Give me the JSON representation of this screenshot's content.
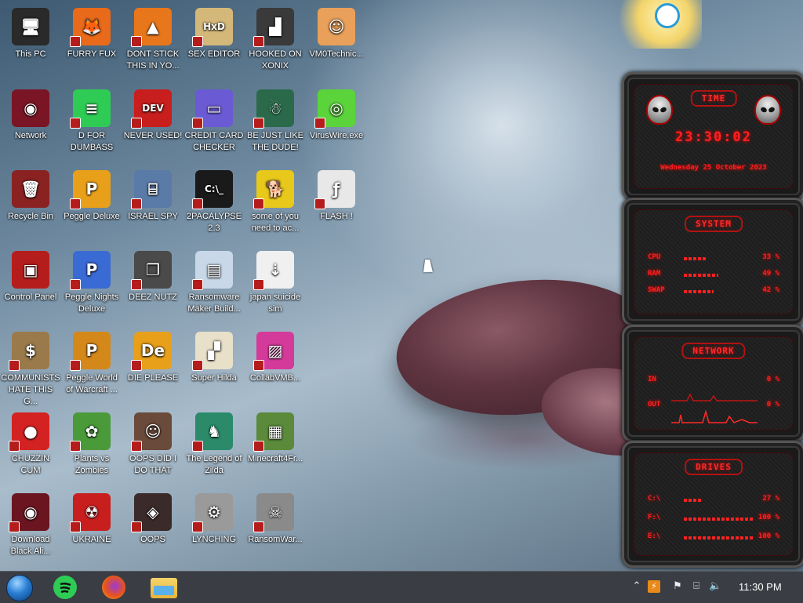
{
  "desktop": {
    "icons": [
      {
        "label": "This PC",
        "icon": "computer-icon",
        "color": "#2a2a2a",
        "glyph": "🖥"
      },
      {
        "label": "Network",
        "icon": "network-icon",
        "color": "#7a1525",
        "glyph": "◉"
      },
      {
        "label": "Recycle Bin",
        "icon": "recycle-bin-icon",
        "color": "#8a2222",
        "glyph": "🗑"
      },
      {
        "label": "Control Panel",
        "icon": "control-panel-icon",
        "color": "#b51d1d",
        "glyph": "▣"
      },
      {
        "label": "COMMUNISTS HATE THIS G...",
        "icon": "money-bag-icon",
        "color": "#9a7a4a",
        "glyph": "$"
      },
      {
        "label": "CHUZZIN CUM",
        "icon": "chuzzle-icon",
        "color": "#d42222",
        "glyph": "●"
      },
      {
        "label": "Download Black Ali...",
        "icon": "alien-icon",
        "color": "#6a1520",
        "glyph": "◉"
      },
      {
        "label": "FURRY FUX",
        "icon": "firefox-icon",
        "color": "#e86a1a",
        "glyph": "🦊"
      },
      {
        "label": "D FOR DUMBASS",
        "icon": "spotify-like-icon",
        "color": "#2ecc55",
        "glyph": "≡"
      },
      {
        "label": "Peggle Deluxe",
        "icon": "peggle-icon",
        "color": "#e8a01a",
        "glyph": "P"
      },
      {
        "label": "Peggle Nights Deluxe",
        "icon": "peggle-nights-icon",
        "color": "#3a6ad4",
        "glyph": "P"
      },
      {
        "label": "Peggle World of Warcraft ...",
        "icon": "peggle-wow-icon",
        "color": "#d4881a",
        "glyph": "P"
      },
      {
        "label": "Plants vs Zombies",
        "icon": "plants-vs-zombies-icon",
        "color": "#4a9a3a",
        "glyph": "✿"
      },
      {
        "label": "UKRAINE",
        "icon": "radiation-icon",
        "color": "#c81e1e",
        "glyph": "☢"
      },
      {
        "label": "DONT STICK THIS IN YO...",
        "icon": "vlc-cone-icon",
        "color": "#e8761a",
        "glyph": "▲"
      },
      {
        "label": "NEVER USED!",
        "icon": "devcpp-icon",
        "color": "#c81e1e",
        "glyph": "DEV"
      },
      {
        "label": "ISRAEL SPY",
        "icon": "network-drive-icon",
        "color": "#5a7aa8",
        "glyph": "⌸"
      },
      {
        "label": "DEEZ NUTZ",
        "icon": "cascade-windows-icon",
        "color": "#4a4a4a",
        "glyph": "❐"
      },
      {
        "label": "DIE PLEASE",
        "icon": "de-logo-icon",
        "color": "#e8a01a",
        "glyph": "De"
      },
      {
        "label": "OOPS DID I DO THAT",
        "icon": "portrait-icon",
        "color": "#6a4a3a",
        "glyph": "☺"
      },
      {
        "label": "OOPS",
        "icon": "dark-app-icon",
        "color": "#3a2a2a",
        "glyph": "◈"
      },
      {
        "label": "SEX EDITOR",
        "icon": "hxd-icon",
        "color": "#d4b87a",
        "glyph": "HxD"
      },
      {
        "label": "CREDIT CARD CHECKER",
        "icon": "credit-card-icon",
        "color": "#6a5ad4",
        "glyph": "▭"
      },
      {
        "label": "2PACALYPSE 2.3",
        "icon": "terminal-icon",
        "color": "#1a1a1a",
        "glyph": "C:\\_"
      },
      {
        "label": "Ransomware Maker Build...",
        "icon": "window-app-icon",
        "color": "#c8d8e8",
        "glyph": "▤"
      },
      {
        "label": "Super Hilda",
        "icon": "pixel-art-icon",
        "color": "#e8e0c8",
        "glyph": "▞"
      },
      {
        "label": "The Legend of Zilda",
        "icon": "zelda-icon",
        "color": "#2a8a6a",
        "glyph": "♞"
      },
      {
        "label": "LYNCHING",
        "icon": "gear-icon",
        "color": "#9a9a9a",
        "glyph": "⚙"
      },
      {
        "label": "HOOKED ON XONIX",
        "icon": "xonix-icon",
        "color": "#3a3a3a",
        "glyph": "▟"
      },
      {
        "label": "BE JUST LIKE THE DUDE!",
        "icon": "gnome-icon",
        "color": "#2a6a4a",
        "glyph": "☃"
      },
      {
        "label": "some of you need to ac...",
        "icon": "dog-icon",
        "color": "#e8c81a",
        "glyph": "🐕"
      },
      {
        "label": "japan suicide sim",
        "icon": "document-arrows-icon",
        "color": "#f0f0f0",
        "glyph": "⇣"
      },
      {
        "label": "CollabVMB...",
        "icon": "collabvm-icon",
        "color": "#d43a9a",
        "glyph": "▨"
      },
      {
        "label": "Minecraft4Fr...",
        "icon": "minecraft-icon",
        "color": "#5a8a3a",
        "glyph": "▦"
      },
      {
        "label": "RansomWar...",
        "icon": "skull-icon",
        "color": "#8a8a8a",
        "glyph": "☠"
      },
      {
        "label": "VM0Technic...",
        "icon": "doctor-icon",
        "color": "#e8a05a",
        "glyph": "☺"
      },
      {
        "label": "VirusWire.exe",
        "icon": "limewire-icon",
        "color": "#5ad43a",
        "glyph": "◎"
      },
      {
        "label": "FLASH !",
        "icon": "flash-doc-icon",
        "color": "#e8e8e8",
        "glyph": "ƒ"
      }
    ]
  },
  "widget": {
    "time_panel": {
      "title": "TIME",
      "time": "23:30:02",
      "date": "Wednesday 25 October 2023"
    },
    "system_panel": {
      "title": "SYSTEM",
      "rows": [
        {
          "label": "CPU",
          "value": "33 %",
          "level": 0.33
        },
        {
          "label": "RAM",
          "value": "49 %",
          "level": 0.49
        },
        {
          "label": "SWAP",
          "value": "42 %",
          "level": 0.42
        }
      ]
    },
    "network_panel": {
      "title": "NETWORK",
      "rows": [
        {
          "label": "IN",
          "value": "0 %"
        },
        {
          "label": "OUT",
          "value": "0 %"
        }
      ]
    },
    "drives_panel": {
      "title": "DRIVES",
      "rows": [
        {
          "label": "C:\\",
          "value": "27 %",
          "level": 0.27
        },
        {
          "label": "F:\\",
          "value": "100 %",
          "level": 1.0
        },
        {
          "label": "E:\\",
          "value": "100 %",
          "level": 1.0
        }
      ]
    },
    "accent_color": "#ff2020"
  },
  "taskbar": {
    "apps": [
      {
        "name": "start-orb",
        "icon": "start-orb-icon"
      },
      {
        "name": "spotify",
        "icon": "spotify-like-icon"
      },
      {
        "name": "firefox",
        "icon": "firefox-icon"
      },
      {
        "name": "file-explorer",
        "icon": "folder-icon"
      }
    ],
    "clock": "11:30 PM"
  }
}
